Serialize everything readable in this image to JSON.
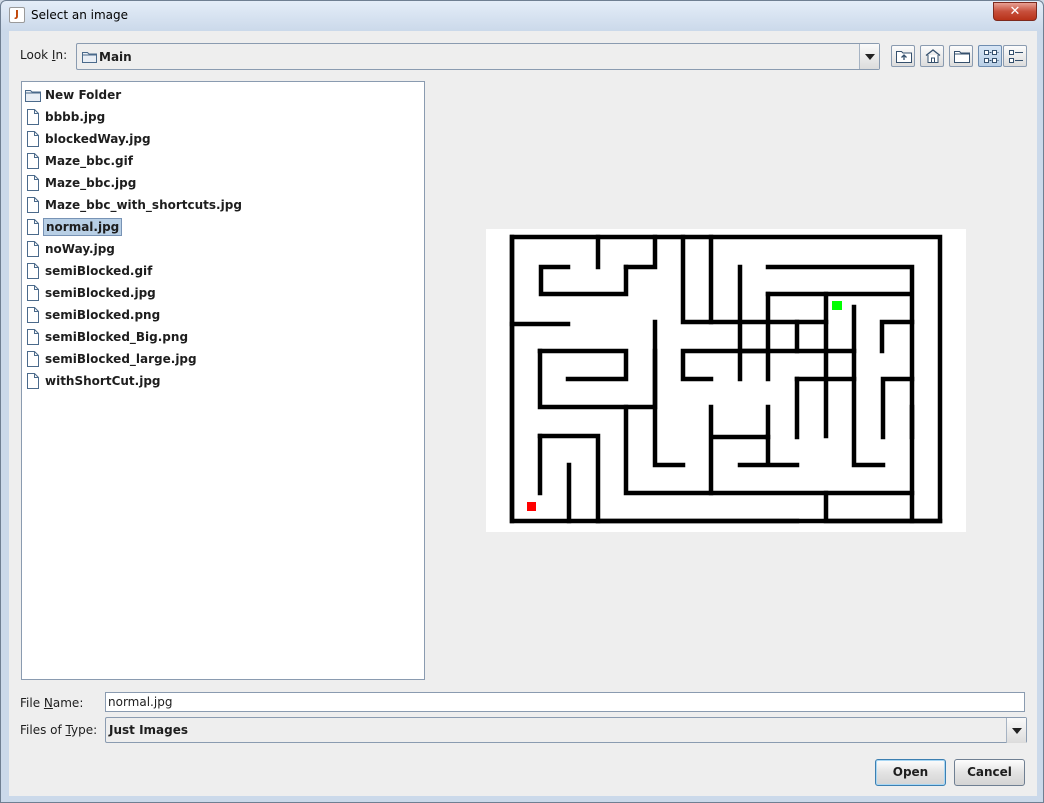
{
  "window": {
    "title": "Select an image"
  },
  "lookin": {
    "label_pre": "Look ",
    "label_mnemonic": "I",
    "label_post": "n:",
    "value": "Main"
  },
  "toolbar": {
    "icons": [
      "up-one-level-icon",
      "home-icon",
      "new-folder-icon",
      "list-view-icon",
      "details-view-icon"
    ]
  },
  "files": [
    {
      "name": "New Folder",
      "type": "folder"
    },
    {
      "name": "bbbb.jpg",
      "type": "file"
    },
    {
      "name": "blockedWay.jpg",
      "type": "file"
    },
    {
      "name": "Maze_bbc.gif",
      "type": "file"
    },
    {
      "name": "Maze_bbc.jpg",
      "type": "file"
    },
    {
      "name": "Maze_bbc_with_shortcuts.jpg",
      "type": "file"
    },
    {
      "name": "normal.jpg",
      "type": "file",
      "selected": true
    },
    {
      "name": "noWay.jpg",
      "type": "file"
    },
    {
      "name": "semiBlocked.gif",
      "type": "file"
    },
    {
      "name": "semiBlocked.jpg",
      "type": "file"
    },
    {
      "name": "semiBlocked.png",
      "type": "file"
    },
    {
      "name": "semiBlocked_Big.png",
      "type": "file"
    },
    {
      "name": "semiBlocked_large.jpg",
      "type": "file"
    },
    {
      "name": "withShortCut.jpg",
      "type": "file"
    }
  ],
  "preview": {
    "start_color": "#ff0000",
    "goal_color": "#00ff00"
  },
  "filename": {
    "label_pre": "File ",
    "label_mnemonic": "N",
    "label_post": "ame:",
    "value": "normal.jpg"
  },
  "filetype": {
    "label_pre": "Files of ",
    "label_mnemonic": "T",
    "label_post": "ype:",
    "value": "Just Images"
  },
  "buttons": {
    "open": "Open",
    "cancel": "Cancel"
  }
}
